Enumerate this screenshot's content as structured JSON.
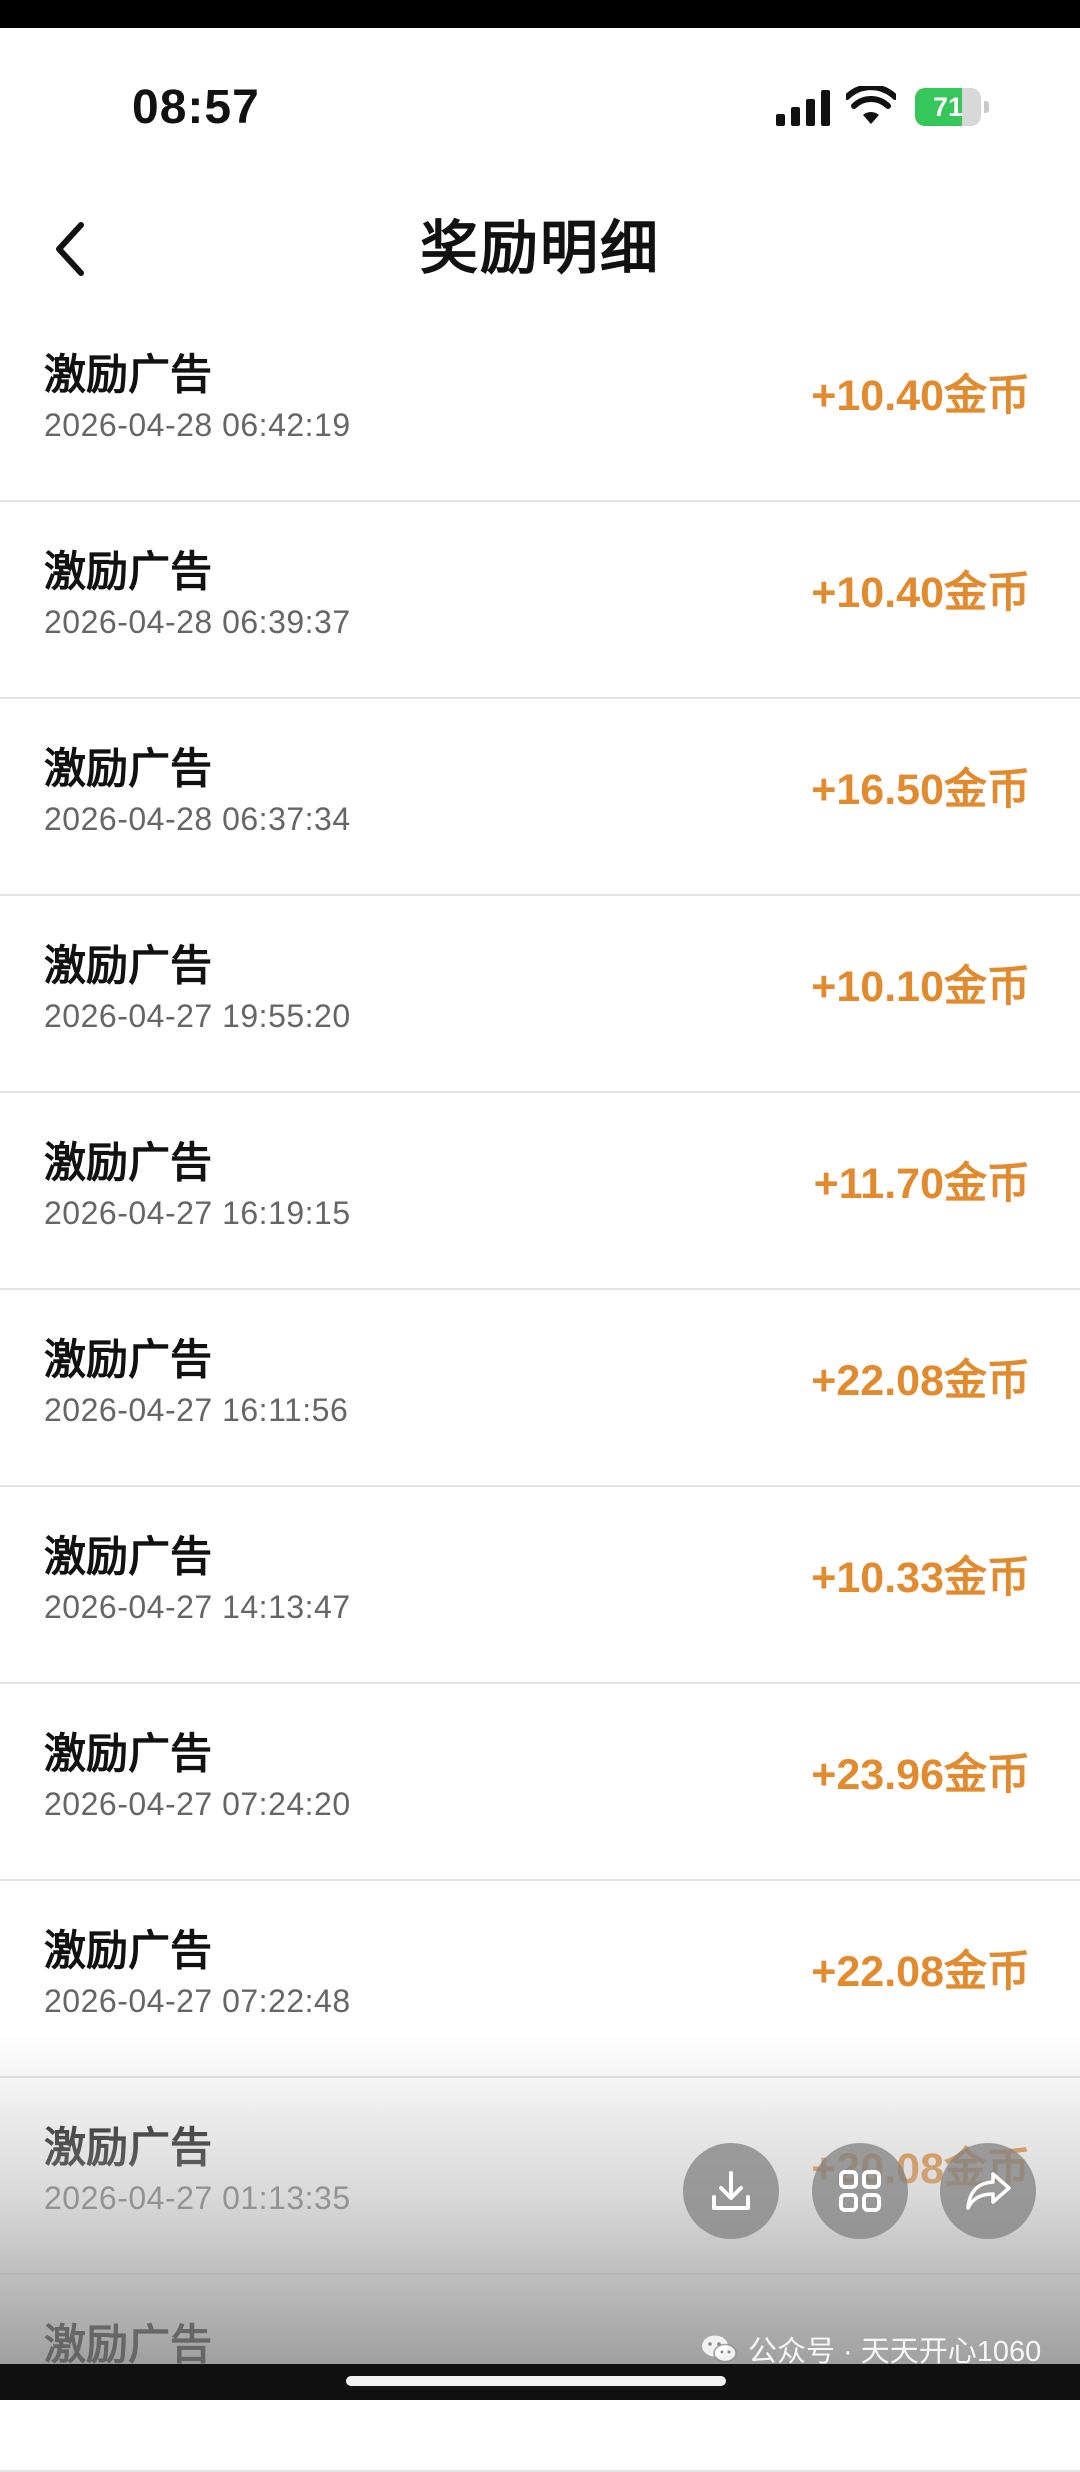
{
  "status_bar": {
    "time": "08:57",
    "battery_level": "71",
    "battery_fraction": 0.71
  },
  "header": {
    "title": "奖励明细",
    "back_icon": "chevron-left-icon"
  },
  "records": [
    {
      "title": "激励广告",
      "time": "2026-04-28 06:42:19",
      "amount": "+10.40金币"
    },
    {
      "title": "激励广告",
      "time": "2026-04-28 06:39:37",
      "amount": "+10.40金币"
    },
    {
      "title": "激励广告",
      "time": "2026-04-28 06:37:34",
      "amount": "+16.50金币"
    },
    {
      "title": "激励广告",
      "time": "2026-04-27 19:55:20",
      "amount": "+10.10金币"
    },
    {
      "title": "激励广告",
      "time": "2026-04-27 16:19:15",
      "amount": "+11.70金币"
    },
    {
      "title": "激励广告",
      "time": "2026-04-27 16:11:56",
      "amount": "+22.08金币"
    },
    {
      "title": "激励广告",
      "time": "2026-04-27 14:13:47",
      "amount": "+10.33金币"
    },
    {
      "title": "激励广告",
      "time": "2026-04-27 07:24:20",
      "amount": "+23.96金币"
    },
    {
      "title": "激励广告",
      "time": "2026-04-27 07:22:48",
      "amount": "+22.08金币"
    },
    {
      "title": "激励广告",
      "time": "2026-04-27 01:13:35",
      "amount": "+20.08金币"
    },
    {
      "title": "激励广告",
      "time": "",
      "amount": ""
    }
  ],
  "overlay": {
    "buttons": [
      {
        "name": "download-icon"
      },
      {
        "name": "grid-icon"
      },
      {
        "name": "share-icon"
      }
    ],
    "watermark": "公众号 · 天天开心1060"
  },
  "colors": {
    "amount": "#e28a2e",
    "battery": "#35c759",
    "divider": "#e4e4e4"
  }
}
